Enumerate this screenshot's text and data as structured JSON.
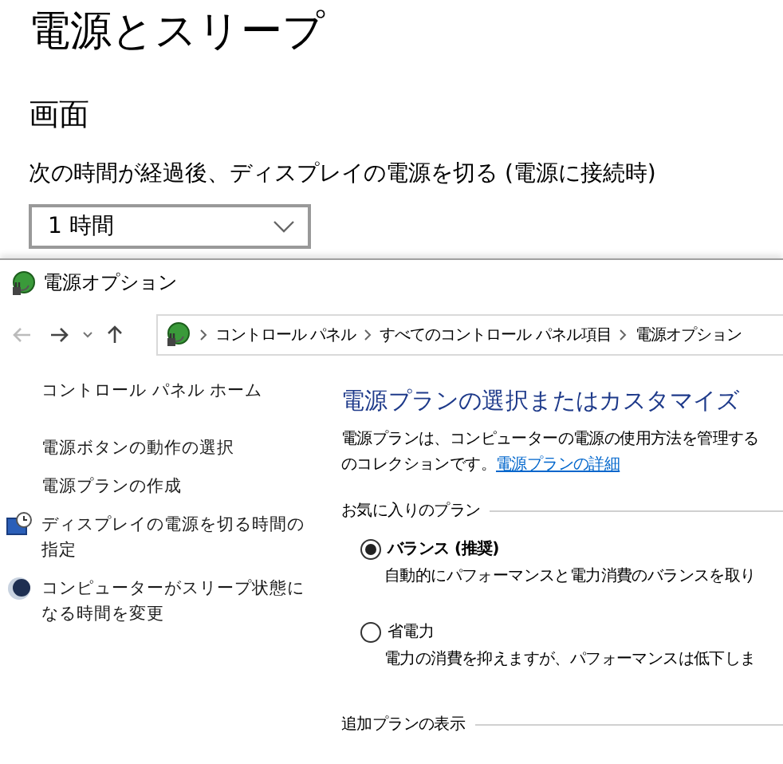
{
  "settings": {
    "title": "電源とスリープ",
    "section": "画面",
    "label": "次の時間が経過後、ディスプレイの電源を切る (電源に接続時)",
    "dropdown": {
      "value": "1 時間"
    }
  },
  "window": {
    "title": "電源オプション",
    "breadcrumb": [
      "コントロール パネル",
      "すべてのコントロール パネル項目",
      "電源オプション"
    ],
    "sidebar": {
      "items": [
        {
          "label": "コントロール パネル ホーム",
          "kind": "home"
        },
        {
          "label": "電源ボタンの動作の選択",
          "kind": "link"
        },
        {
          "label": "電源プランの作成",
          "kind": "link"
        },
        {
          "label": "ディスプレイの電源を切る時間の指定",
          "kind": "display"
        },
        {
          "label": "コンピューターがスリープ状態になる時間を変更",
          "kind": "sleep"
        }
      ]
    },
    "main": {
      "heading": "電源プランの選択またはカスタマイズ",
      "description": [
        "電源プランは、コンピューターの電源の使用方法を管理する",
        "のコレクションです。"
      ],
      "link": "電源プランの詳細",
      "favorites": {
        "heading": "お気に入りのプラン",
        "plans": [
          {
            "name": "バランス (推奨)",
            "selected": true,
            "description": "自動的にパフォーマンスと電力消費のバランスを取り"
          },
          {
            "name": "省電力",
            "selected": false,
            "description": "電力の消費を抑えますが、パフォーマンスは低下しま"
          }
        ]
      },
      "more": "追加プランの表示"
    }
  }
}
